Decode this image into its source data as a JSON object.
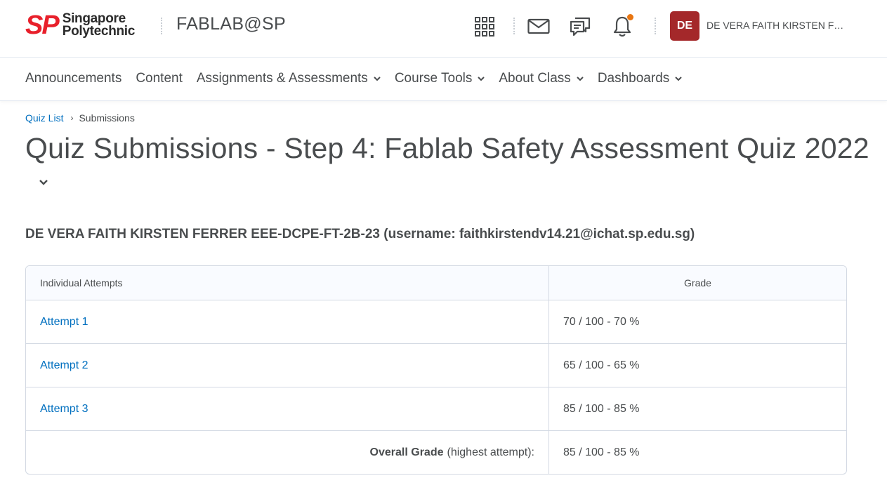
{
  "header": {
    "logo_mark": "SP",
    "logo_line1": "Singapore",
    "logo_line2": "Polytechnic",
    "org_title": "FABLAB@SP",
    "avatar_initials": "DE",
    "user_name": "DE VERA FAITH KIRSTEN FERRER",
    "avatar_color": "#a4282a",
    "notification_dot_color": "#e87511",
    "icons": [
      "waffle-icon",
      "mail-icon",
      "chat-icon",
      "bell-icon"
    ]
  },
  "nav": {
    "items": [
      {
        "label": "Announcements",
        "has_menu": false
      },
      {
        "label": "Content",
        "has_menu": false
      },
      {
        "label": "Assignments & Assessments",
        "has_menu": true
      },
      {
        "label": "Course Tools",
        "has_menu": true
      },
      {
        "label": "About Class",
        "has_menu": true
      },
      {
        "label": "Dashboards",
        "has_menu": true
      }
    ]
  },
  "breadcrumb": {
    "link": "Quiz List",
    "current": "Submissions"
  },
  "page": {
    "title": "Quiz Submissions - Step 4: Fablab Safety Assessment Quiz 2022",
    "student": "DE VERA FAITH KIRSTEN FERRER EEE-DCPE-FT-2B-23 (username: faithkirstendv14.21@ichat.sp.edu.sg)"
  },
  "table": {
    "headers": [
      "Individual Attempts",
      "Grade"
    ],
    "rows": [
      {
        "attempt": "Attempt 1",
        "grade": "70 / 100 - 70 %"
      },
      {
        "attempt": "Attempt 2",
        "grade": "65 / 100 - 65 %"
      },
      {
        "attempt": "Attempt 3",
        "grade": "85 / 100 - 85 %"
      }
    ],
    "overall_label": "Overall Grade",
    "overall_note": "(highest attempt):",
    "overall_grade": "85 / 100 - 85 %"
  },
  "colors": {
    "link": "#006fbf",
    "text": "#494c4e",
    "brand_red": "#e8202b"
  }
}
